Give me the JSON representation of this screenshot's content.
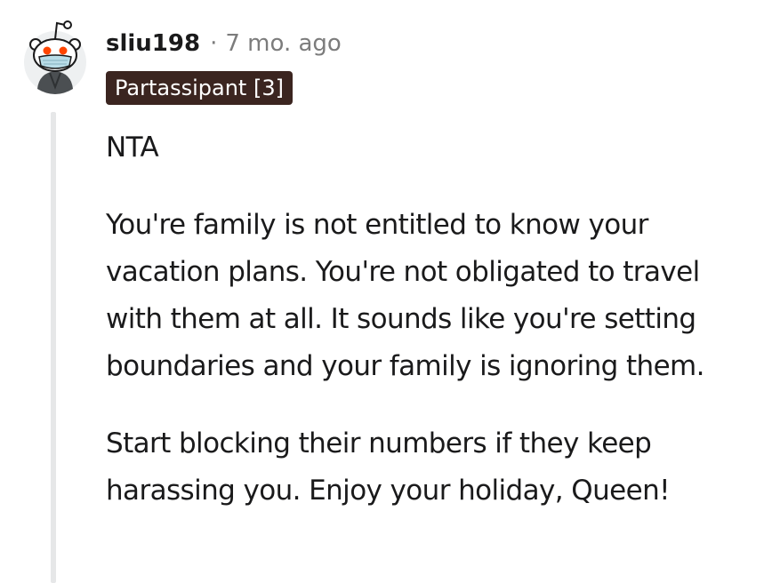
{
  "comment": {
    "username": "sliu198",
    "separator": "·",
    "timestamp": "7 mo. ago",
    "flair": "Partassipant [3]",
    "paragraphs": [
      "NTA",
      "You're family is not entitled to know your vacation plans. You're not obligated to travel with them at all. It sounds like you're setting boundaries and your family is ignoring them.",
      "Start blocking their numbers if they keep harassing you. Enjoy your holiday, Queen!"
    ]
  },
  "avatar": {
    "icon": "reddit-snoo-masked-icon",
    "colors": {
      "background": "#eef0f1",
      "eye": "#ff4500",
      "mask": "#b9dde8",
      "body": "#4b4f52"
    }
  },
  "colors": {
    "flair_bg": "#3b2520",
    "flair_text": "#ffffff",
    "meta_gray": "#7c7c7c",
    "text": "#1a1a1b",
    "thread_line": "#e6e7e8"
  }
}
